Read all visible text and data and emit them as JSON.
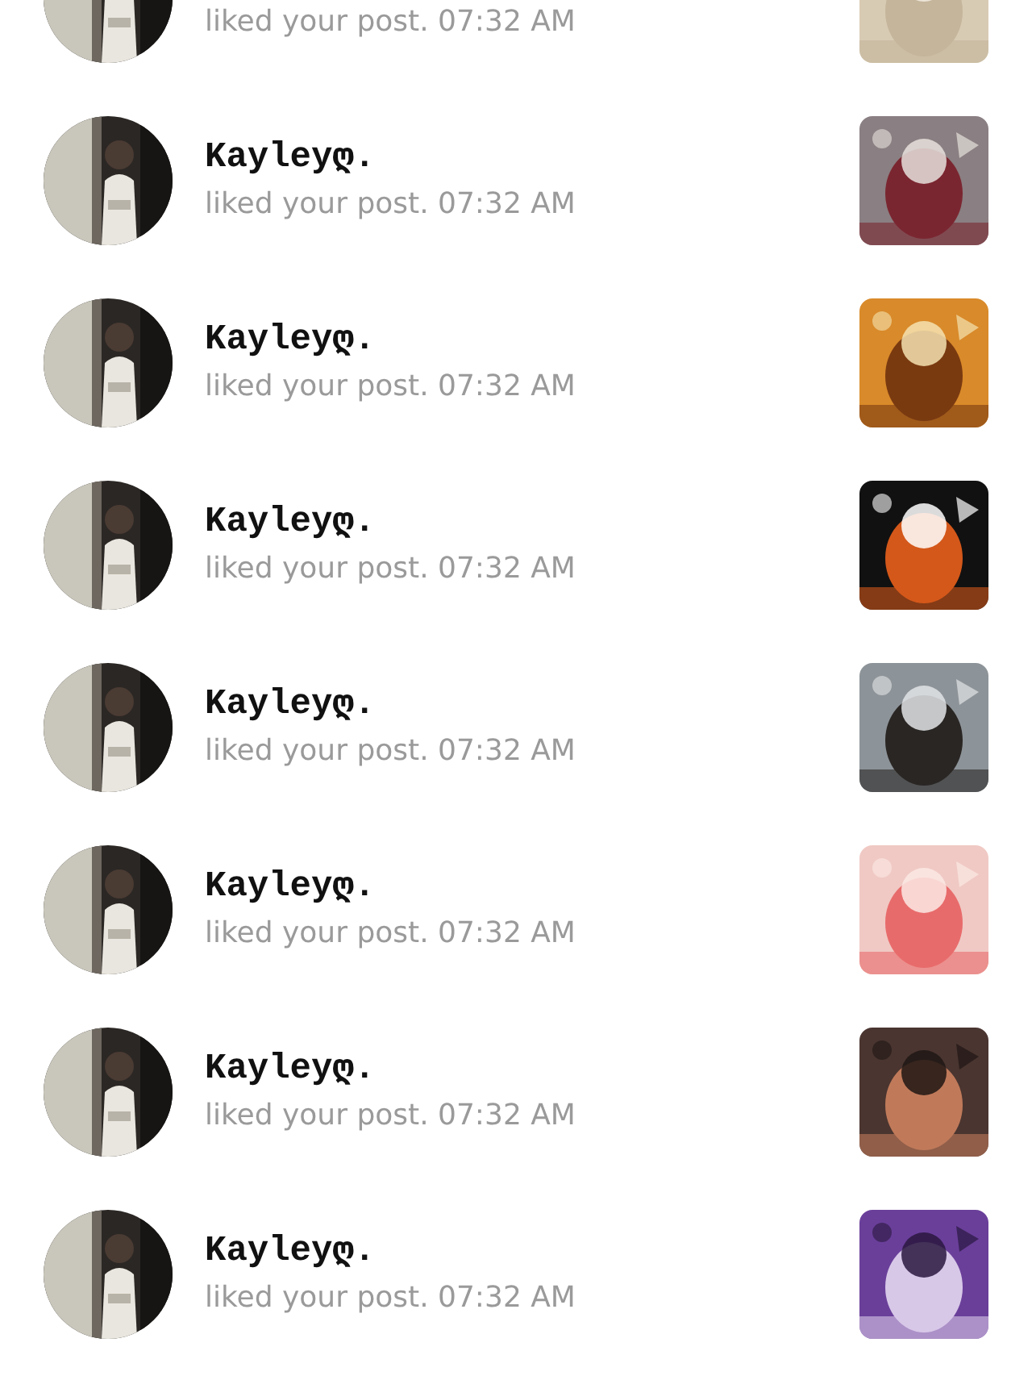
{
  "notifications": [
    {
      "text": "liked your post. 07:32 AM"
    },
    {
      "name": "Kayleyღ.",
      "text": "liked your post. 07:32 AM"
    },
    {
      "name": "Kayleyღ.",
      "text": "liked your post. 07:32 AM"
    },
    {
      "name": "Kayleyღ.",
      "text": "liked your post. 07:32 AM"
    },
    {
      "name": "Kayleyღ.",
      "text": "liked your post. 07:32 AM"
    },
    {
      "name": "Kayleyღ.",
      "text": "liked your post. 07:32 AM"
    },
    {
      "name": "Kayleyღ.",
      "text": "liked your post. 07:32 AM"
    },
    {
      "name": "Kayleyღ.",
      "text": "liked your post. 07:32 AM"
    }
  ]
}
